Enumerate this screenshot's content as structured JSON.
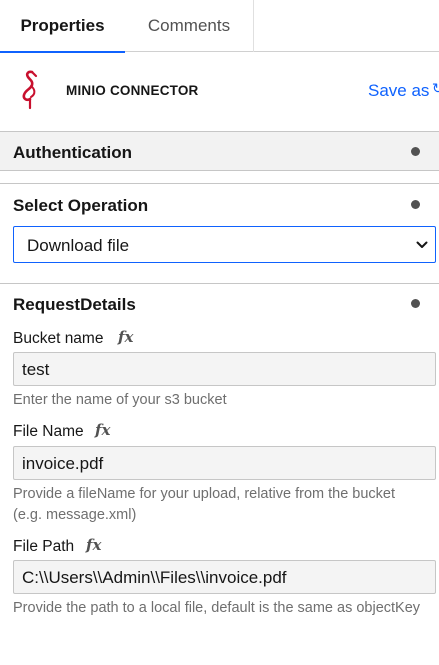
{
  "tabs": {
    "properties": "Properties",
    "comments": "Comments"
  },
  "header": {
    "app_name": "MINIO CONNECTOR",
    "save_as": "Save as",
    "brand_color": "#c8102e",
    "accent_color": "#0f62fe"
  },
  "sections": {
    "authentication": "Authentication",
    "select_operation": "Select Operation",
    "request_details": "RequestDetails"
  },
  "operation": {
    "selected": "Download file"
  },
  "fields": [
    {
      "label": "Bucket name",
      "fx": "fx",
      "value": "test",
      "helper": "Enter the name of your s3 bucket"
    },
    {
      "label": "File Name",
      "fx": "fx",
      "value": "invoice.pdf",
      "helper": "Provide a fileName for your upload, relative from the bucket (e.g. message.xml)"
    },
    {
      "label": "File Path",
      "fx": "fx",
      "value": "C:\\\\Users\\\\Admin\\\\Files\\\\invoice.pdf",
      "helper": "Provide the path to a local file, default is the same as objectKey"
    }
  ]
}
